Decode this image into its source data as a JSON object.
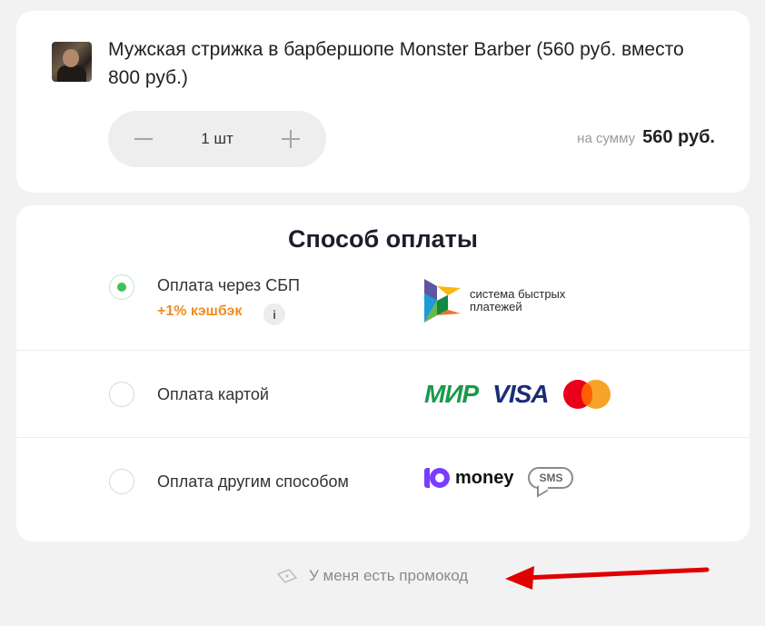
{
  "product": {
    "title": "Мужская стрижка в барбершопе Monster Barber (560 руб. вместо 800 руб.)",
    "quantity": "1 шт",
    "sum_label": "на сумму",
    "sum_value": "560 руб."
  },
  "payment": {
    "title": "Способ оплаты",
    "options": [
      {
        "label": "Оплата через СБП",
        "checked": true,
        "cashback": "+1% кэшбэк",
        "info": "i",
        "logo_text": "система быстрых платежей"
      },
      {
        "label": "Оплата картой",
        "checked": false,
        "brands": [
          "МИР",
          "VISA",
          "mastercard"
        ]
      },
      {
        "label": "Оплата другим способом",
        "checked": false,
        "brands": [
          "money",
          "SMS"
        ]
      }
    ]
  },
  "promo": {
    "label": "У меня есть промокод"
  },
  "colors": {
    "accent_green": "#3fc256",
    "cashback_orange": "#f08c1e",
    "annotation_red": "#e00000"
  }
}
